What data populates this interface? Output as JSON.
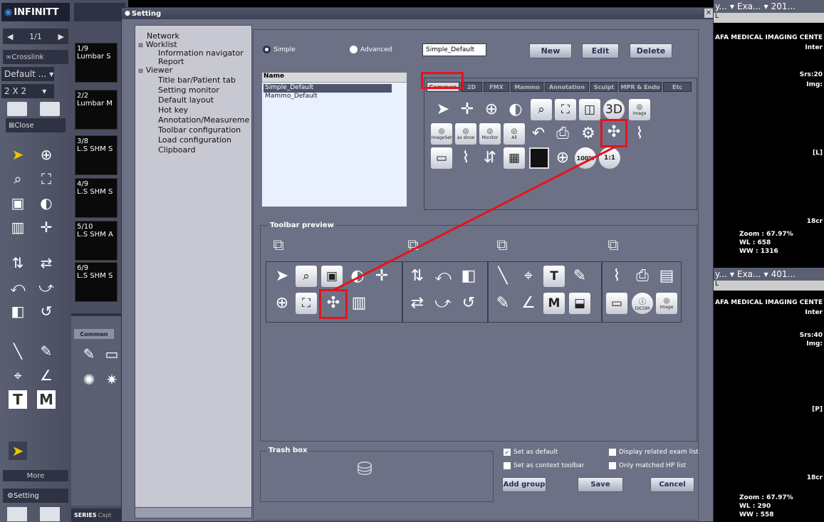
{
  "app": {
    "logo": "INFINITT",
    "page": "1/1",
    "crosslink": "Crosslink",
    "layout_default": "Default ...",
    "layout_grid": "2 X 2",
    "close": "Close",
    "more": "More",
    "setting": "Setting",
    "bottom_tabs": [
      "SERIES",
      "Capt"
    ],
    "common_tab": "Common"
  },
  "thumbs": [
    {
      "n": "1/9",
      "t": "Lumbar",
      "s": "S"
    },
    {
      "n": "2/2",
      "t": "Lumbar",
      "s": "M"
    },
    {
      "n": "3/8",
      "t": "L.S SHM",
      "s": "S"
    },
    {
      "n": "4/9",
      "t": "L.S SHM",
      "s": "S"
    },
    {
      "n": "5/10",
      "t": "L.S SHM",
      "s": "A"
    },
    {
      "n": "6/9",
      "t": "L.S SHM",
      "s": "S"
    }
  ],
  "dialog": {
    "title": "Setting",
    "tree": [
      "Network",
      "Worklist",
      "Information navigator",
      "Report",
      "Viewer",
      "Title bar/Patient tab",
      "Setting monitor",
      "Default layout",
      "Hot key",
      "Annotation/Measureme",
      "Toolbar configuration",
      "Load configuration",
      "Clipboard"
    ],
    "mode_simple": "Simple",
    "mode_advanced": "Advanced",
    "profile_value": "Simple_Default",
    "new_button": "New",
    "edit_button": "Edit",
    "delete_button": "Delete",
    "name_header": "Name",
    "names": [
      "Simple_Default",
      "Mammo_Default"
    ],
    "tabs": [
      "Common",
      "2D",
      "FMX",
      "Mammo",
      "Annotation",
      "Sculpt",
      "MPR & Endo",
      "Etc"
    ],
    "image_label": "Image",
    "imageset_label": "ImageSet",
    "asshow_label": "as show",
    "monitor_label": "Monitor",
    "all_label": "All",
    "one_to_one": "1:1",
    "hundred": "100%",
    "toolbar_preview": "Toolbar preview",
    "trash_box": "Trash box",
    "set_default": "Set as default",
    "set_context": "Set as context toolbar",
    "related_exam": "Display related exam list",
    "matched_hp": "Only matched HP list",
    "add_group": "Add group",
    "save": "Save",
    "cancel": "Cancel",
    "dicom_label": "DICOM",
    "image_label2": "Image"
  },
  "right": {
    "hdr1": {
      "a": "y...",
      "b": "Exa...",
      "c": "201..."
    },
    "hdr2": {
      "a": "y...",
      "b": "Exa...",
      "c": "401..."
    },
    "l1": "L",
    "l2": "L",
    "center1": "AFA MEDICAL IMAGING CENTE",
    "inter1": "Inter",
    "srs1": "Srs:20",
    "img1": "Img:",
    "lmark1": "[L]",
    "cm1": "18cr",
    "zoom1": "Zoom : 67.97%",
    "wl1": "WL : 658",
    "ww1": "WW : 1316",
    "center2": "AFA MEDICAL IMAGING CENTE",
    "inter2": "Inter",
    "srs2": "Srs:40",
    "img2": "Img:",
    "pmark2": "[P]",
    "cm2": "18cr",
    "zoom2": "Zoom : 67.97%",
    "wl2": "WL : 290",
    "ww2": "WW : 558"
  },
  "colors": {
    "dialog_bg": "#6d7186",
    "panel_bg": "#c7c8d1",
    "highlight": "#e3141d",
    "title_bar": "#42475a"
  }
}
